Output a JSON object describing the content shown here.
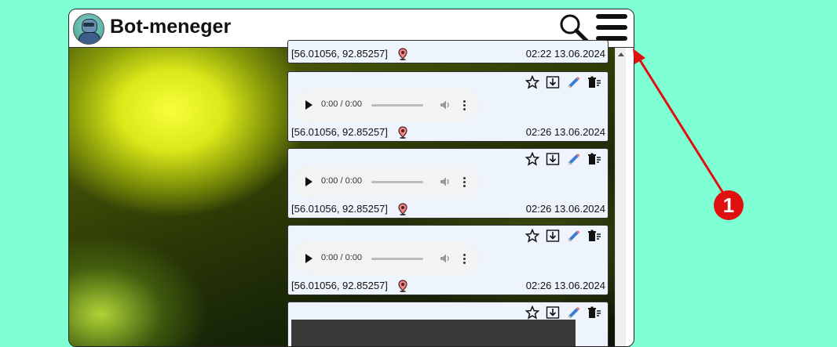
{
  "app": {
    "title": "Bot-meneger"
  },
  "header": {
    "search_icon": "search-icon",
    "menu_icon": "hamburger-menu-icon"
  },
  "messages": [
    {
      "type": "partial",
      "coords": "[56.01056, 92.85257]",
      "timestamp": "02:22 13.06.2024"
    },
    {
      "type": "audio",
      "audio_time": "0:00 / 0:00",
      "coords": "[56.01056, 92.85257]",
      "timestamp": "02:26 13.06.2024"
    },
    {
      "type": "audio",
      "audio_time": "0:00 / 0:00",
      "coords": "[56.01056, 92.85257]",
      "timestamp": "02:26 13.06.2024"
    },
    {
      "type": "audio",
      "audio_time": "0:00 / 0:00",
      "coords": "[56.01056, 92.85257]",
      "timestamp": "02:26 13.06.2024"
    },
    {
      "type": "media"
    }
  ],
  "toolbar_icons": [
    "star-icon",
    "download-icon",
    "pencil-icon",
    "trash-icon"
  ],
  "annotation": {
    "badge_label": "1",
    "color": "#e01010"
  },
  "colors": {
    "page_background": "#7fffd4",
    "message_background": "#edf4fc"
  }
}
